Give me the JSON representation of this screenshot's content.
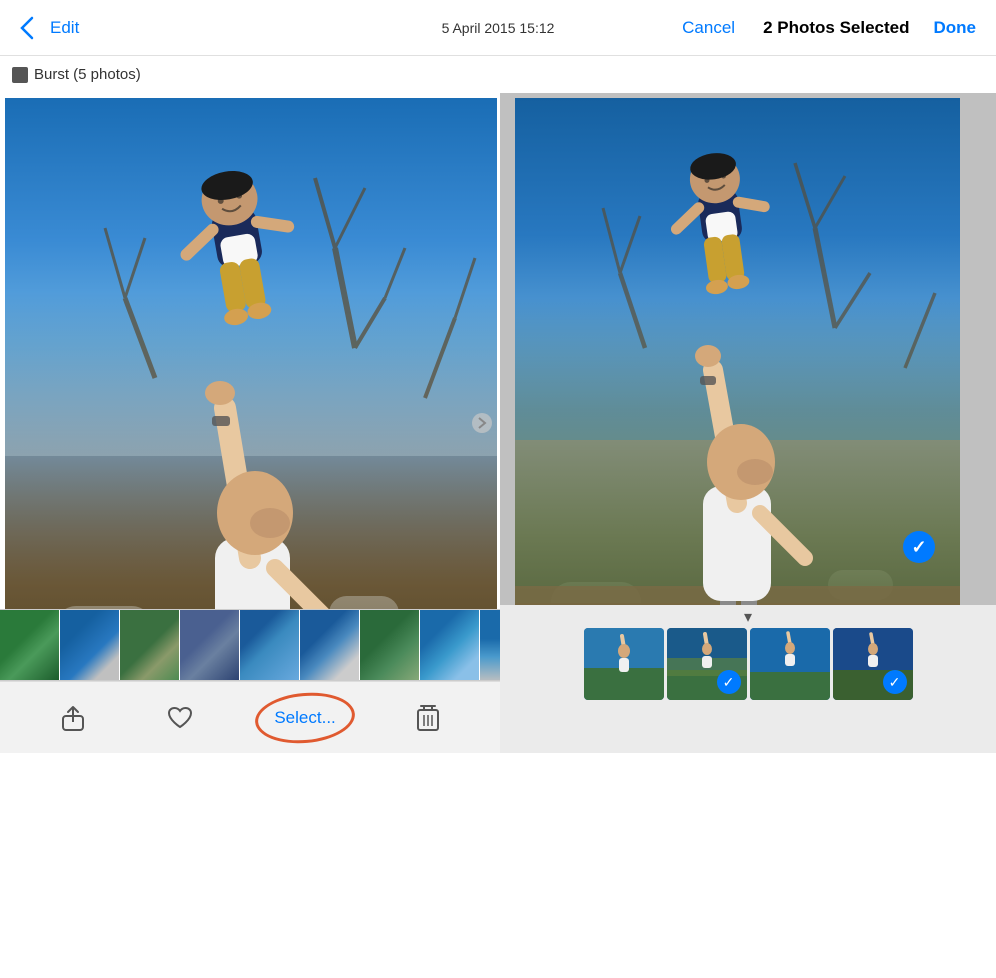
{
  "header": {
    "back_label": "‹",
    "date_text": "5 April 2015  15:12",
    "edit_label": "Edit",
    "cancel_label": "Cancel",
    "selection_title": "2 Photos Selected",
    "done_label": "Done"
  },
  "burst": {
    "label": "Burst (5 photos)"
  },
  "toolbar": {
    "share_label": "share",
    "favorite_label": "favorite",
    "select_label": "Select...",
    "delete_label": "delete"
  },
  "thumbnails": {
    "count": 10
  },
  "right_panel": {
    "arrow_down": "▾"
  },
  "colors": {
    "accent": "#007aff",
    "circle_highlight": "#e05a30",
    "background": "#ffffff"
  }
}
